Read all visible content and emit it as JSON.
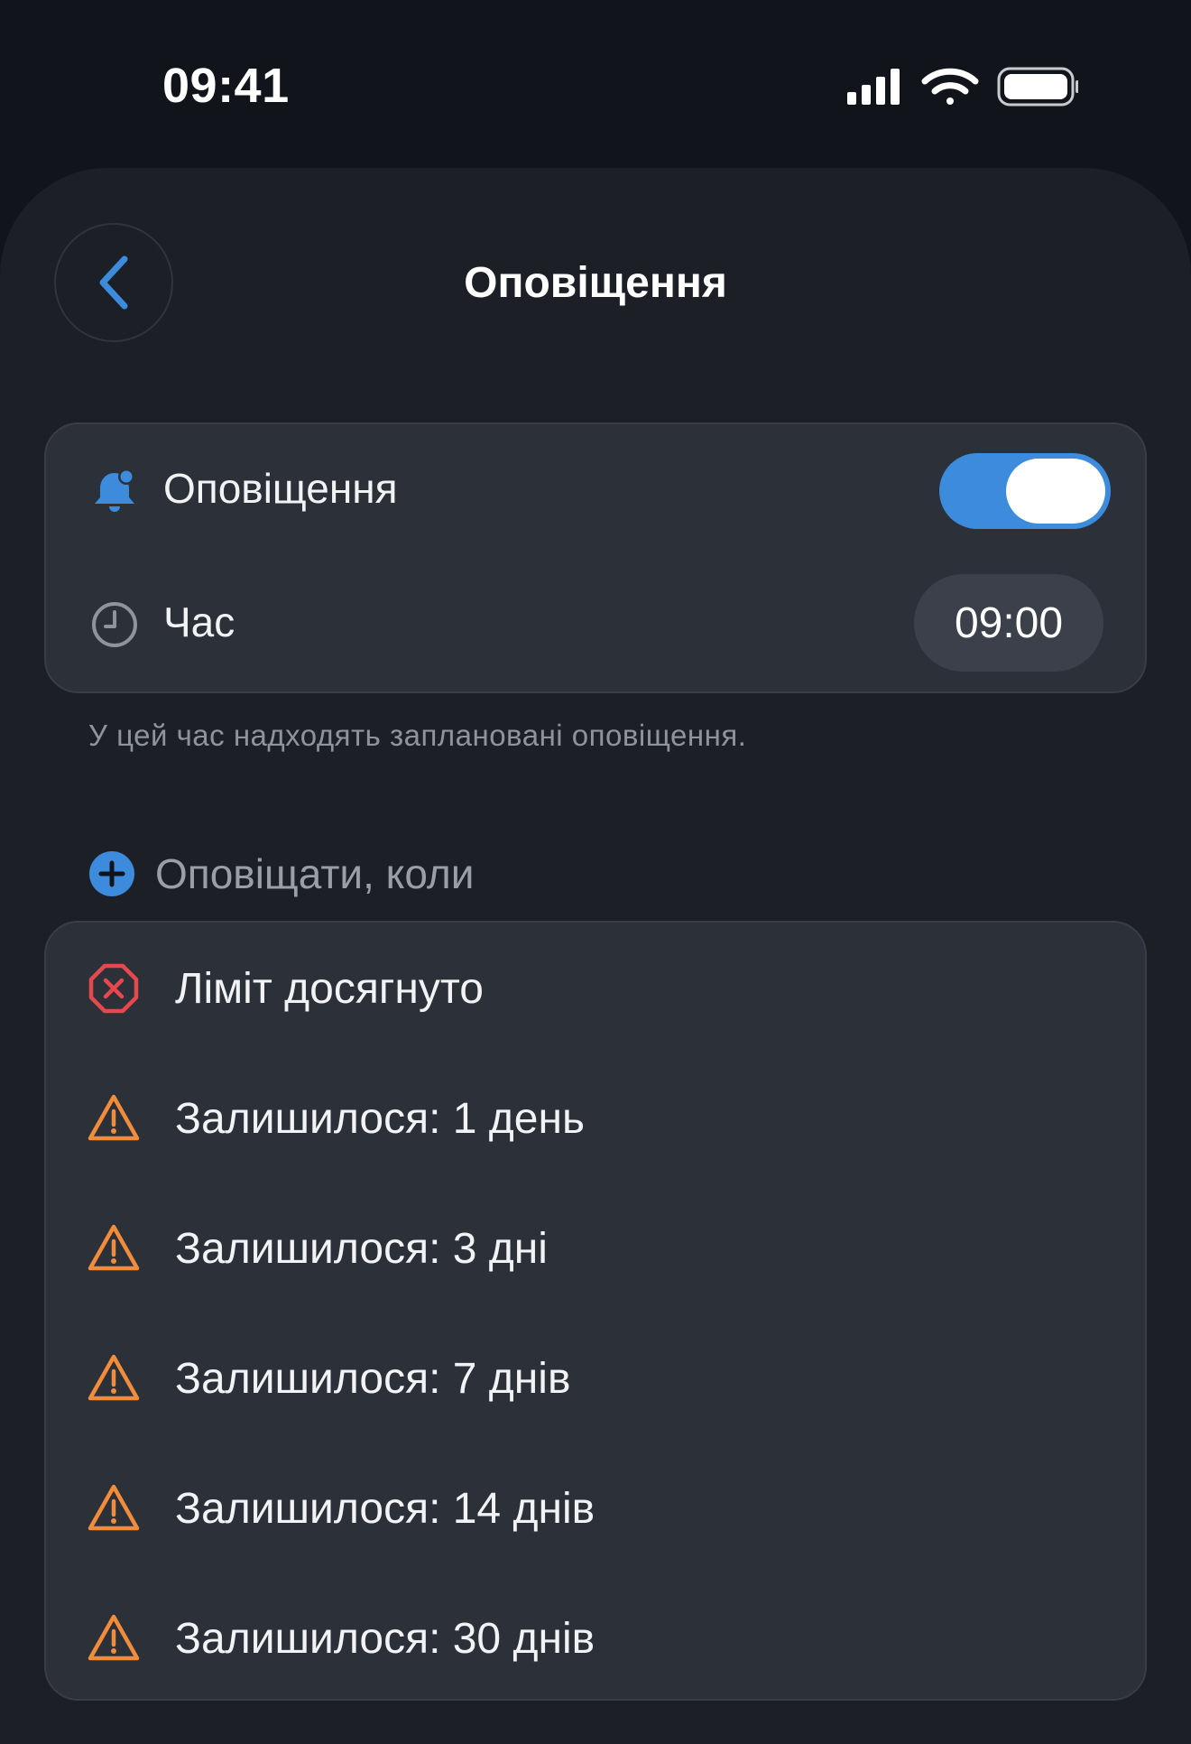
{
  "status_bar": {
    "time": "09:41",
    "icons": [
      "signal-icon",
      "wifi-icon",
      "battery-icon"
    ]
  },
  "header": {
    "title": "Оповіщення",
    "back_icon": "chevron-left-icon"
  },
  "settings": {
    "notifications": {
      "label": "Оповіщення",
      "icon": "bell-badge-icon",
      "enabled": true
    },
    "time": {
      "label": "Час",
      "icon": "clock-icon",
      "value": "09:00"
    },
    "hint": "У цей час надходять заплановані оповіщення."
  },
  "alerts_section": {
    "title": "Оповіщати, коли",
    "add_icon": "plus-circle-icon",
    "items": [
      {
        "label": "Ліміт досягнуто",
        "icon": "x-octagon-icon",
        "color": "#e5484d"
      },
      {
        "label": "Залишилося: 1 день",
        "icon": "warning-triangle-icon",
        "color": "#f08c3a"
      },
      {
        "label": "Залишилося: 3 дні",
        "icon": "warning-triangle-icon",
        "color": "#f08c3a"
      },
      {
        "label": "Залишилося: 7 днів",
        "icon": "warning-triangle-icon",
        "color": "#f08c3a"
      },
      {
        "label": "Залишилося: 14 днів",
        "icon": "warning-triangle-icon",
        "color": "#f08c3a"
      },
      {
        "label": "Залишилося: 30 днів",
        "icon": "warning-triangle-icon",
        "color": "#f08c3a"
      }
    ]
  },
  "colors": {
    "accent": "#3d8bdc",
    "background": "#11151b",
    "sheet": "#1c1f26",
    "card": "#2b3039"
  }
}
